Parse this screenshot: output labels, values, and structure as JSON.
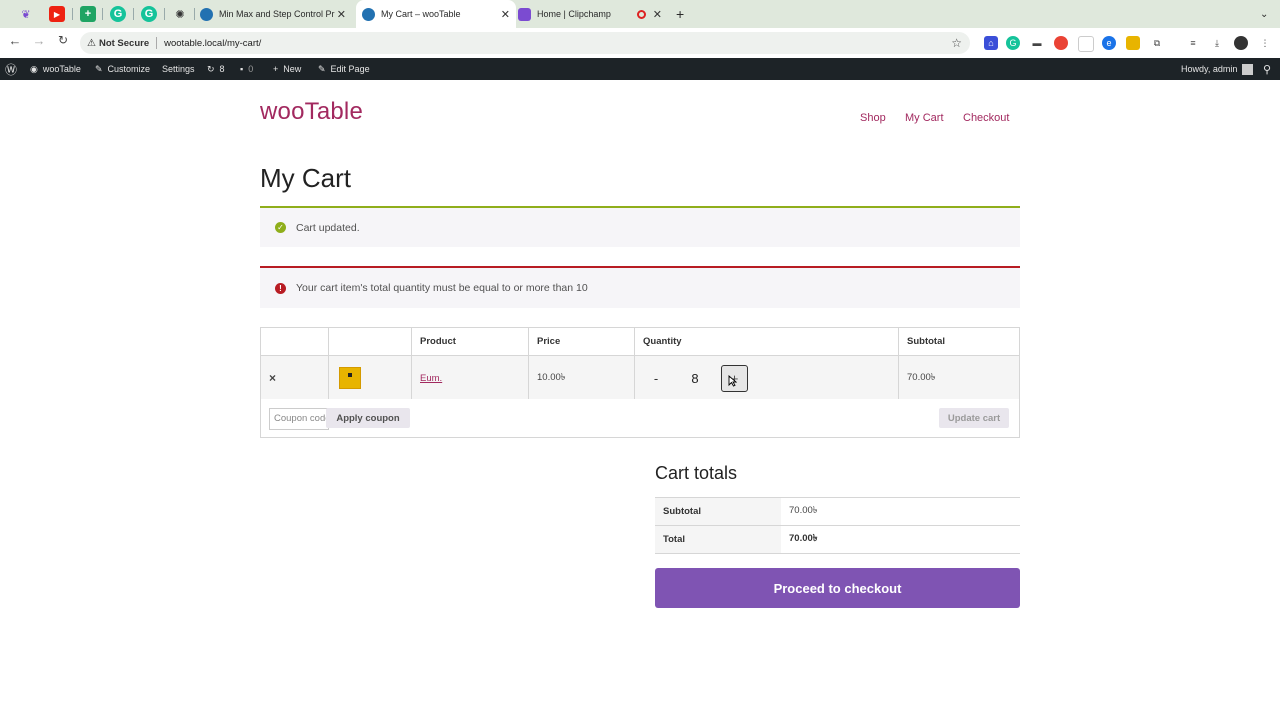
{
  "browser": {
    "tabs": [
      {
        "title": "Min Max and Step Control Pr"
      },
      {
        "title": "My Cart – wooTable"
      },
      {
        "title": "Home | Clipchamp"
      }
    ],
    "new_tab": "+",
    "not_secure": "Not Secure",
    "url": "wootable.local/my-cart/"
  },
  "adminbar": {
    "site": "wooTable",
    "customize": "Customize",
    "settings": "Settings",
    "updates_count": "8",
    "comments_count": "0",
    "new": "New",
    "edit_page": "Edit Page",
    "howdy": "Howdy, admin"
  },
  "site": {
    "title": "wooTable",
    "menu": [
      "Shop",
      "My Cart",
      "Checkout"
    ]
  },
  "page": {
    "title": "My Cart",
    "success_notice": "Cart updated.",
    "error_notice": "Your cart item's total quantity must be equal to or more than 10"
  },
  "cart": {
    "headers": {
      "product": "Product",
      "price": "Price",
      "quantity": "Quantity",
      "subtotal": "Subtotal"
    },
    "item": {
      "remove": "×",
      "name": "Eum.",
      "price": "10.00৳",
      "qty_minus": "-",
      "quantity": "8",
      "qty_plus": "+",
      "subtotal": "70.00৳"
    },
    "coupon_placeholder": "Coupon code",
    "apply_coupon": "Apply coupon",
    "update_cart": "Update cart"
  },
  "totals": {
    "title": "Cart totals",
    "subtotal_label": "Subtotal",
    "subtotal_value": "70.00৳",
    "total_label": "Total",
    "total_value": "70.00৳",
    "checkout": "Proceed to checkout"
  },
  "colors": {
    "accent": "#a2295f",
    "checkout": "#7f54b3",
    "success": "#8fae1b",
    "error": "#b81c23"
  }
}
